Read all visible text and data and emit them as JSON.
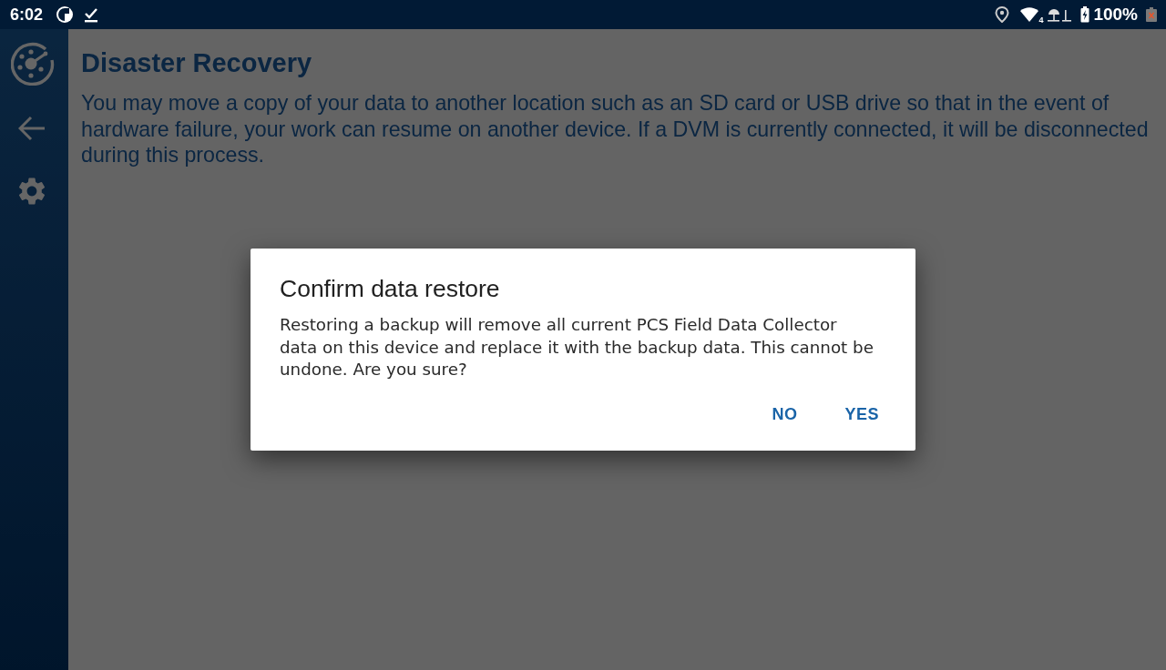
{
  "status_bar": {
    "time": "6:02",
    "network_label": "4",
    "battery_percent": "100%"
  },
  "page": {
    "title": "Disaster Recovery",
    "description": "You may move a copy of your data to another location such as an SD card or USB drive so that in the event of hardware failure, your work can resume on another device. If a DVM is currently connected, it will be disconnected during this process."
  },
  "dialog": {
    "title": "Confirm data restore",
    "message": "Restoring a backup will remove all current PCS Field Data Collector data on this device and replace it with the backup data. This cannot be undone. Are you sure?",
    "buttons": [
      "NO",
      "YES"
    ]
  }
}
